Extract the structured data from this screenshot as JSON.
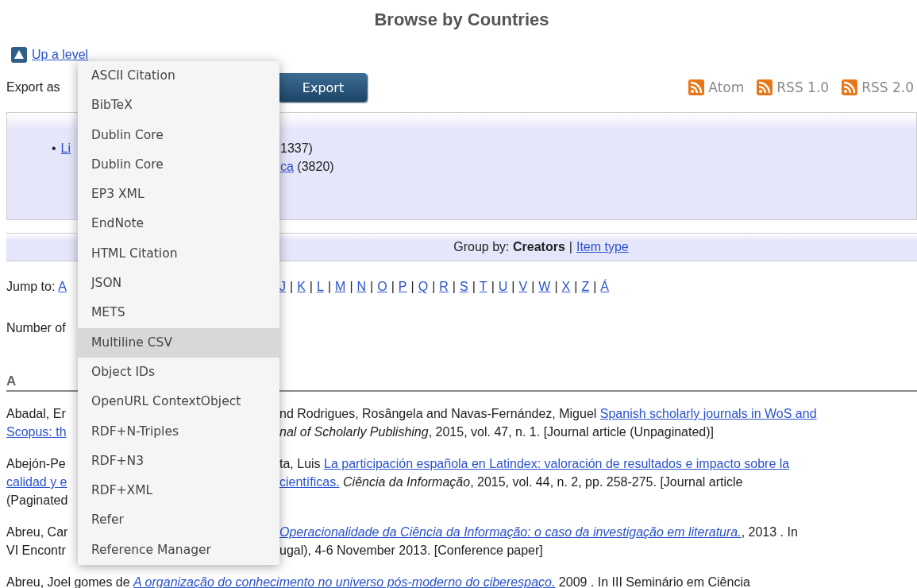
{
  "title": "Browse by Countries",
  "up_link": "Up a level",
  "export": {
    "label": "Export as",
    "button": "Export"
  },
  "feeds": [
    {
      "label": "Atom"
    },
    {
      "label": "RSS 1.0"
    },
    {
      "label": "RSS 2.0"
    }
  ],
  "countries": [
    {
      "bullet": "•",
      "left": "Li",
      "right": [
        {
          "kind": "text",
          "text": "1337)"
        }
      ]
    },
    {
      "right": [
        {
          "kind": "link",
          "text": "ca"
        },
        {
          "kind": "text",
          "text": " (3820)"
        }
      ]
    }
  ],
  "group_by": {
    "label": "Group by:",
    "current": "Creators",
    "separator": "|",
    "option": "Item type"
  },
  "jump_to": {
    "label": "Jump to:",
    "left_letters": [
      "A"
    ],
    "right_letters": [
      "J",
      "K",
      "L",
      "M",
      "N",
      "O",
      "P",
      "Q",
      "R",
      "S",
      "T",
      "U",
      "V",
      "W",
      "X",
      "Z",
      "Á"
    ],
    "separator": "|"
  },
  "number_of": "Number of",
  "section": "A",
  "citations": [
    {
      "lines": [
        {
          "kind": "split",
          "left": {
            "kind": "text",
            "text": "Abadal, Er"
          },
          "right": [
            {
              "kind": "text",
              "text": "nd Rodrigues, Rosângela and Navas-Fernández, Miguel "
            },
            {
              "kind": "link",
              "text": "Spanish scholarly journals in WoS and"
            }
          ]
        },
        {
          "kind": "split",
          "left": {
            "kind": "link",
            "text": "Scopus: th"
          },
          "right": [
            {
              "kind": "italic",
              "text": "nal of Scholarly Publishing"
            },
            {
              "kind": "text",
              "text": ", 2015, vol. 47, n. 1. [Journal article (Unpaginated)]"
            }
          ]
        }
      ]
    },
    {
      "lines": [
        {
          "kind": "split",
          "left": {
            "kind": "text",
            "text": "Abejón-Pe"
          },
          "right": [
            {
              "kind": "text",
              "text": "ta, Luis "
            },
            {
              "kind": "link",
              "text": "La participación española en Latindex: valoración de resultados e impacto sobre la"
            }
          ]
        },
        {
          "kind": "split",
          "left": {
            "kind": "link",
            "text": "calidad y e"
          },
          "right": [
            {
              "kind": "link",
              "text": "científicas."
            },
            {
              "kind": "italic",
              "text": " Ciência da Informação"
            },
            {
              "kind": "text",
              "text": ", 2015, vol. 44, n. 2, pp. 258-275. [Journal article"
            }
          ]
        },
        {
          "kind": "split",
          "left": {
            "kind": "text",
            "text": "(Paginated"
          }
        }
      ]
    },
    {
      "lines": [
        {
          "kind": "split",
          "left": {
            "kind": "text",
            "text": "Abreu, Car"
          },
          "right": [
            {
              "kind": "italic-link",
              "text": "Operacionalidade da Ciência da Informação: o caso da investigação em literatura."
            },
            {
              "kind": "text",
              "text": ", 2013 . In"
            }
          ]
        },
        {
          "kind": "split",
          "left": {
            "kind": "text",
            "text": "VI Encontr"
          },
          "right": [
            {
              "kind": "text",
              "text": "ugal), 4-6 November 2013. [Conference paper]"
            }
          ]
        }
      ]
    },
    {
      "lines": [
        {
          "kind": "full",
          "right": [
            {
              "kind": "text",
              "text": "Abreu, Joel gomes de "
            },
            {
              "kind": "italic-link",
              "text": "A organização do conhecimento no universo pós-moderno do ciberespaço."
            },
            {
              "kind": "text",
              "text": " 2009 . In III Seminário em Ciência"
            }
          ]
        }
      ]
    }
  ],
  "menu": {
    "items": [
      {
        "label": "ASCII Citation",
        "selected": false
      },
      {
        "label": "BibTeX",
        "selected": false
      },
      {
        "label": "Dublin Core",
        "selected": false
      },
      {
        "label": "Dublin Core",
        "selected": false
      },
      {
        "label": "EP3 XML",
        "selected": false
      },
      {
        "label": "EndNote",
        "selected": false
      },
      {
        "label": "HTML Citation",
        "selected": false
      },
      {
        "label": "JSON",
        "selected": false
      },
      {
        "label": "METS",
        "selected": false
      },
      {
        "label": "Multiline CSV",
        "selected": true
      },
      {
        "label": "Object IDs",
        "selected": false
      },
      {
        "label": "OpenURL ContextObject",
        "selected": false
      },
      {
        "label": "RDF+N-Triples",
        "selected": false
      },
      {
        "label": "RDF+N3",
        "selected": false
      },
      {
        "label": "RDF+XML",
        "selected": false
      },
      {
        "label": "Refer",
        "selected": false
      },
      {
        "label": "Reference Manager",
        "selected": false
      }
    ]
  }
}
